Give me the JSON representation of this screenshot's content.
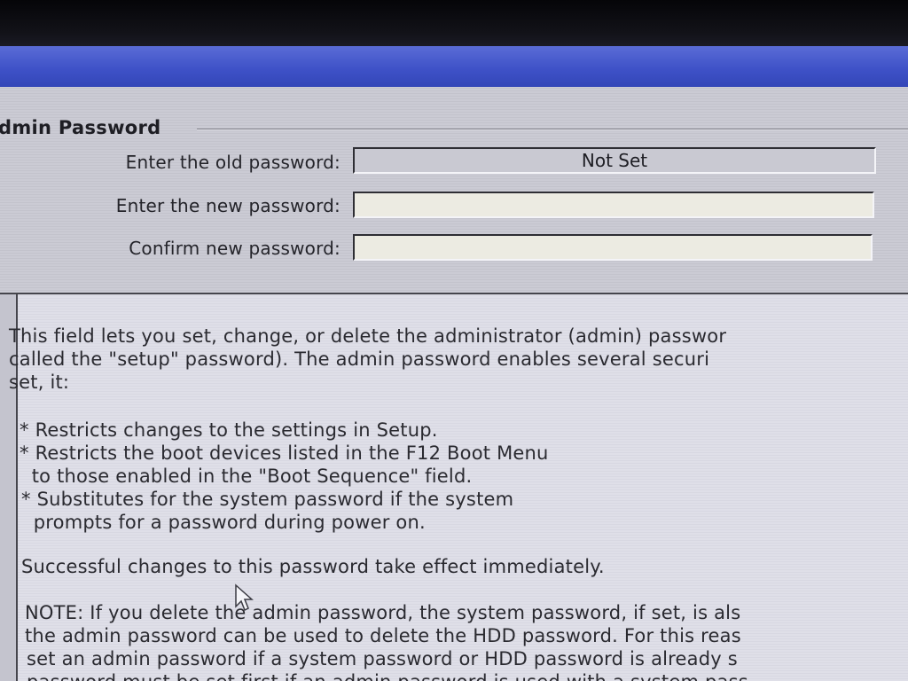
{
  "group": {
    "title": "dmin Password"
  },
  "fields": [
    {
      "label": "Enter the old password:",
      "value": "Not Set"
    },
    {
      "label": "Enter the new password:",
      "value": ""
    },
    {
      "label": "Confirm new password:",
      "value": ""
    }
  ],
  "help": {
    "intro": [
      "This field lets you set, change, or delete the administrator (admin) passwor",
      "called the \"setup\" password).  The admin password enables several securi",
      "set, it:"
    ],
    "bullets": [
      "* Restricts changes to the settings in Setup.",
      "* Restricts the boot devices listed in the F12 Boot Menu",
      "  to those enabled in the \"Boot Sequence\" field.",
      "* Substitutes for the system password if the system",
      "  prompts for a password during power on."
    ],
    "effect": "Successful changes to this password take effect immediately.",
    "note": [
      "NOTE: If you delete the admin password, the system password, if set, is als",
      "the admin password can be used to delete the HDD password.  For this reas",
      "set an admin password if a system password or HDD password is already s",
      "password must be set first if an admin password is used with a system pass"
    ]
  }
}
